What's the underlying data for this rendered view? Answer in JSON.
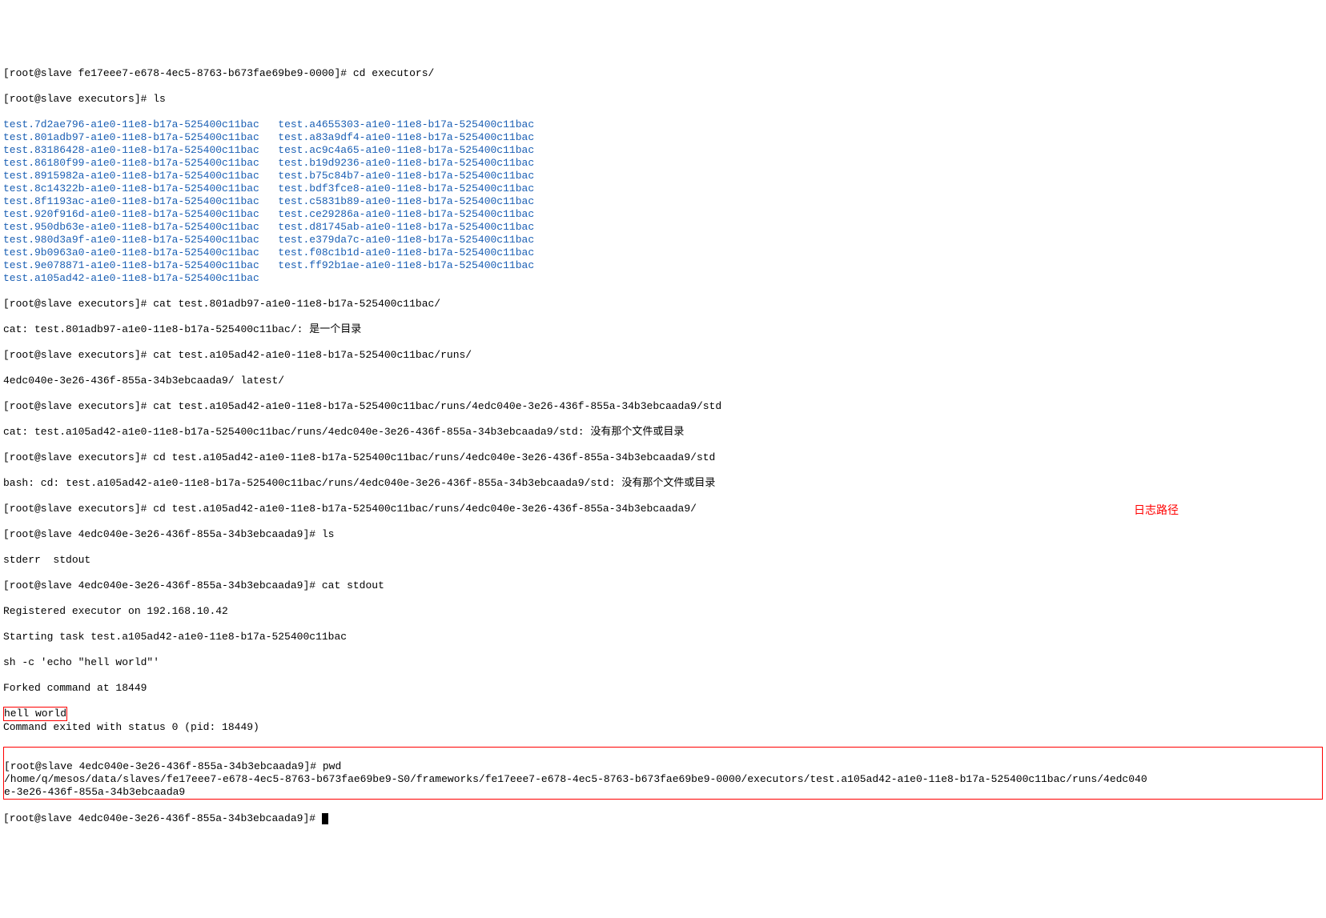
{
  "line1_prompt": "[root@slave fe17eee7-e678-4ec5-8763-b673fae69be9-0000]# ",
  "line1_cmd": "cd executors/",
  "line2_prompt": "[root@slave executors]# ",
  "line2_cmd": "ls",
  "files_col1": [
    "test.7d2ae796-a1e0-11e8-b17a-525400c11bac",
    "test.801adb97-a1e0-11e8-b17a-525400c11bac",
    "test.83186428-a1e0-11e8-b17a-525400c11bac",
    "test.86180f99-a1e0-11e8-b17a-525400c11bac",
    "test.8915982a-a1e0-11e8-b17a-525400c11bac",
    "test.8c14322b-a1e0-11e8-b17a-525400c11bac",
    "test.8f1193ac-a1e0-11e8-b17a-525400c11bac",
    "test.920f916d-a1e0-11e8-b17a-525400c11bac",
    "test.950db63e-a1e0-11e8-b17a-525400c11bac",
    "test.980d3a9f-a1e0-11e8-b17a-525400c11bac",
    "test.9b0963a0-a1e0-11e8-b17a-525400c11bac",
    "test.9e078871-a1e0-11e8-b17a-525400c11bac",
    "test.a105ad42-a1e0-11e8-b17a-525400c11bac"
  ],
  "files_col2": [
    "test.a4655303-a1e0-11e8-b17a-525400c11bac",
    "test.a83a9df4-a1e0-11e8-b17a-525400c11bac",
    "test.ac9c4a65-a1e0-11e8-b17a-525400c11bac",
    "test.b19d9236-a1e0-11e8-b17a-525400c11bac",
    "test.b75c84b7-a1e0-11e8-b17a-525400c11bac",
    "test.bdf3fce8-a1e0-11e8-b17a-525400c11bac",
    "test.c5831b89-a1e0-11e8-b17a-525400c11bac",
    "test.ce29286a-a1e0-11e8-b17a-525400c11bac",
    "test.d81745ab-a1e0-11e8-b17a-525400c11bac",
    "test.e379da7c-a1e0-11e8-b17a-525400c11bac",
    "test.f08c1b1d-a1e0-11e8-b17a-525400c11bac",
    "test.ff92b1ae-a1e0-11e8-b17a-525400c11bac"
  ],
  "line3_prompt": "[root@slave executors]# ",
  "line3_cmd": "cat test.801adb97-a1e0-11e8-b17a-525400c11bac/",
  "line4": "cat: test.801adb97-a1e0-11e8-b17a-525400c11bac/: 是一个目录",
  "line5_prompt": "[root@slave executors]# ",
  "line5_cmd": "cat test.a105ad42-a1e0-11e8-b17a-525400c11bac/runs/",
  "line6": "4edc040e-3e26-436f-855a-34b3ebcaada9/ latest/",
  "line7_prompt": "[root@slave executors]# ",
  "line7_cmd": "cat test.a105ad42-a1e0-11e8-b17a-525400c11bac/runs/4edc040e-3e26-436f-855a-34b3ebcaada9/std",
  "line8": "cat: test.a105ad42-a1e0-11e8-b17a-525400c11bac/runs/4edc040e-3e26-436f-855a-34b3ebcaada9/std: 没有那个文件或目录",
  "line9_prompt": "[root@slave executors]# ",
  "line9_cmd": "cd test.a105ad42-a1e0-11e8-b17a-525400c11bac/runs/4edc040e-3e26-436f-855a-34b3ebcaada9/std",
  "line10": "bash: cd: test.a105ad42-a1e0-11e8-b17a-525400c11bac/runs/4edc040e-3e26-436f-855a-34b3ebcaada9/std: 没有那个文件或目录",
  "line11_prompt": "[root@slave executors]# ",
  "line11_cmd": "cd test.a105ad42-a1e0-11e8-b17a-525400c11bac/runs/4edc040e-3e26-436f-855a-34b3ebcaada9/",
  "line12_prompt": "[root@slave 4edc040e-3e26-436f-855a-34b3ebcaada9]# ",
  "line12_cmd": "ls",
  "line13": "stderr  stdout",
  "line14_prompt": "[root@slave 4edc040e-3e26-436f-855a-34b3ebcaada9]# ",
  "line14_cmd": "cat stdout",
  "line15": "Registered executor on 192.168.10.42",
  "line16": "Starting task test.a105ad42-a1e0-11e8-b17a-525400c11bac",
  "line17": "sh -c 'echo \"hell world\"'",
  "line18": "Forked command at 18449",
  "line19": "hell world",
  "line20": "Command exited with status 0 (pid: 18449)",
  "line21_prompt": "[root@slave 4edc040e-3e26-436f-855a-34b3ebcaada9]# ",
  "line21_cmd": "pwd",
  "line22a": "/home/q/mesos/data/slaves/fe17eee7-e678-4ec5-8763-b673fae69be9-S0/frameworks/fe17eee7-e678-4ec5-8763-b673fae69be9-0000/executors/test.a105ad42-a1e0-11e8-b17a-525400c11bac/runs/4edc040",
  "line22b": "e-3e26-436f-855a-34b3ebcaada9",
  "line23_prompt": "[root@slave 4edc040e-3e26-436f-855a-34b3ebcaada9]# ",
  "red_label": "日志路径"
}
